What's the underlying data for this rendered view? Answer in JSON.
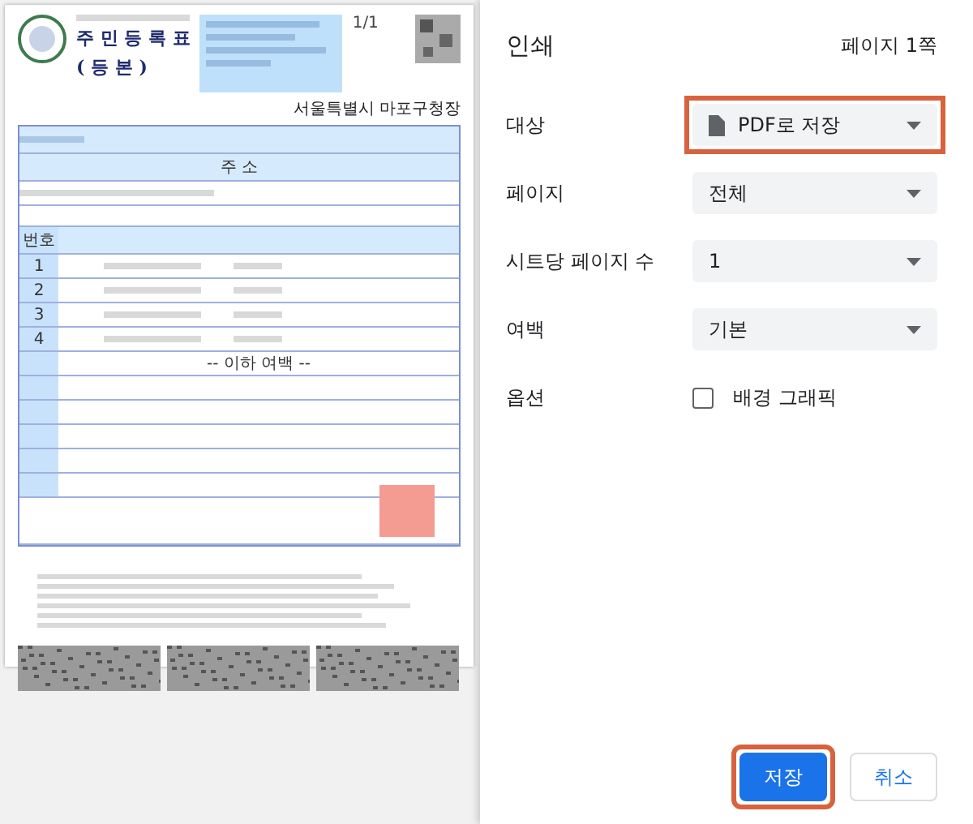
{
  "preview": {
    "page_number": "1/1",
    "doc_title": "주 민 등 록 표",
    "doc_subtitle": "( 등 본 )",
    "issuer": "서울특별시 마포구청장",
    "address_header": "주 소",
    "no_header": "번호",
    "row_numbers": [
      "1",
      "2",
      "3",
      "4"
    ],
    "blank_note": "-- 이하 여백 --"
  },
  "panel": {
    "title": "인쇄",
    "page_count": "페이지 1쪽",
    "settings": [
      {
        "label": "대상",
        "kind": "select",
        "value": "PDF로 저장",
        "icon": true,
        "highlighted": true
      },
      {
        "label": "페이지",
        "kind": "select",
        "value": "전체",
        "icon": false,
        "highlighted": false
      },
      {
        "label": "시트당 페이지 수",
        "kind": "select",
        "value": "1",
        "icon": false,
        "highlighted": false
      },
      {
        "label": "여백",
        "kind": "select",
        "value": "기본",
        "icon": false,
        "highlighted": false
      },
      {
        "label": "옵션",
        "kind": "checkbox",
        "value": "배경 그래픽",
        "checked": false
      }
    ]
  },
  "buttons": [
    {
      "label": "저장",
      "kind": "primary",
      "highlighted": true
    },
    {
      "label": "취소",
      "kind": "secondary",
      "highlighted": false
    }
  ]
}
